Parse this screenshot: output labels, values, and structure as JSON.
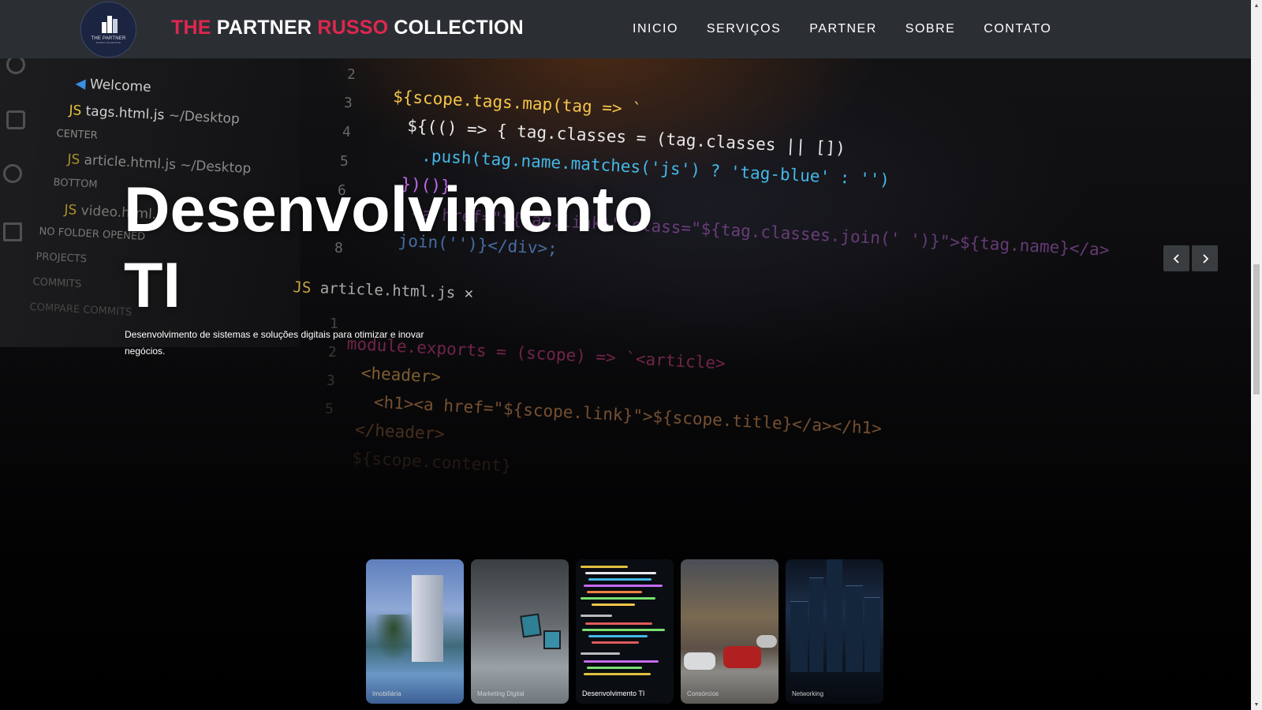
{
  "header": {
    "logo": {
      "text": "THE PARTNER",
      "subtext": "RUSSO COLLECTION"
    },
    "brand": {
      "part1": "THE",
      "part2": "PARTNER",
      "part3": "RUSSO",
      "part4": "COLLECTION"
    },
    "accent_color": "#e0264e",
    "nav": [
      "INICIO",
      "SERVIÇOS",
      "PARTNER",
      "SOBRE",
      "CONTATO"
    ]
  },
  "hero": {
    "title": "Desenvolvimento TI",
    "subtitle": "Desenvolvimento de sistemas e soluções digitais para otimizar e inovar negócios.",
    "prev_icon": "chevron-left-icon",
    "next_icon": "chevron-right-icon"
  },
  "background_code": {
    "sidebar": [
      "Welcome",
      "tags.html.js",
      "~/Desktop",
      "CENTER",
      "article.html.js",
      "~/Desktop",
      "BOTTOM",
      "video.html.js",
      "NO FOLDER OPENED",
      "PROJECTS",
      "COMMITS",
      "COMPARE COMMITS"
    ],
    "tab": "article.html.js",
    "gutter": [
      "2",
      "3",
      "4",
      "5",
      "6",
      "7",
      "8",
      "1",
      "2",
      "3",
      "5"
    ],
    "lines_top": [
      "${scope.tags.map(tag => `",
      "${(() => { tag.classes = (tag.classes || [])",
      ".push(tag.name.matches('js') ? 'tag-blue' : '')",
      "})()}",
      "<a href=\"${tag.link}\" class=\"${tag.classes.join(' ')}\">${tag.name}</a>",
      "join('')}</div>;"
    ],
    "lines_bottom": [
      "module.exports = (scope) => `<article>",
      "<header>",
      "<h1><a href=\"${scope.link}\">${scope.title}</a></h1>",
      "</header>",
      "${scope.content}"
    ]
  },
  "thumbnails": [
    {
      "label": "Imobiliária",
      "active": false
    },
    {
      "label": "Marketing Digital",
      "active": false
    },
    {
      "label": "Desenvolvimento TI",
      "active": true
    },
    {
      "label": "Consórcios",
      "active": false
    },
    {
      "label": "Networking",
      "active": false
    }
  ]
}
